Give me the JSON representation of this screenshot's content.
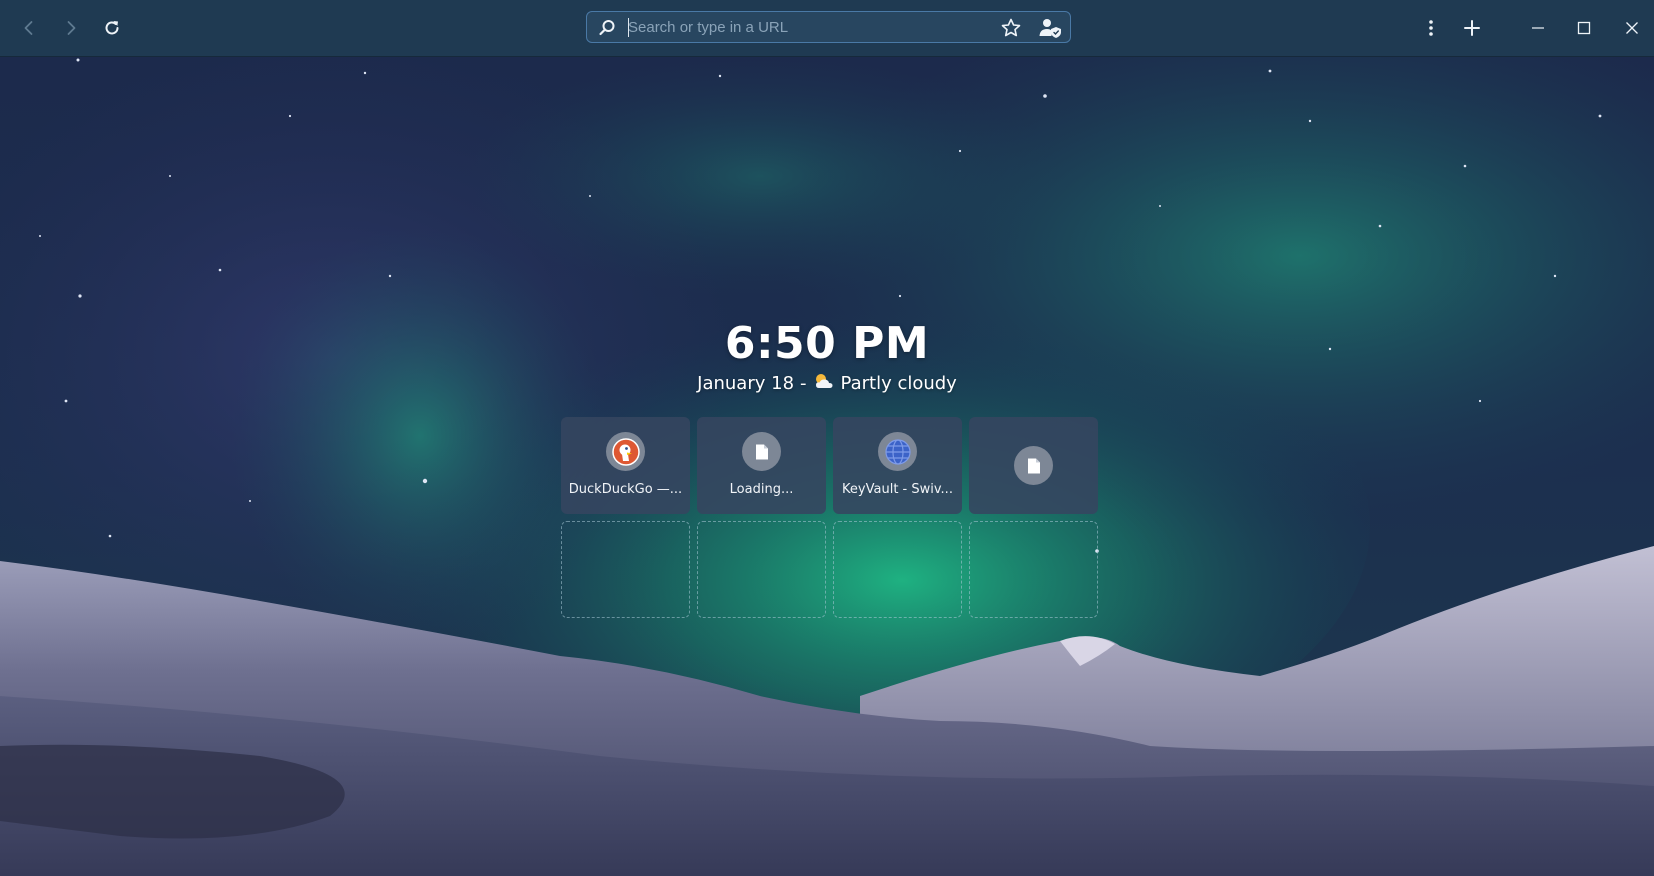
{
  "toolbar": {
    "back_icon": "chevron-left-icon",
    "forward_icon": "chevron-right-icon",
    "reload_icon": "reload-icon",
    "menu_icon": "kebab-menu-icon",
    "new_tab_icon": "plus-icon",
    "minimize_icon": "minimize-icon",
    "maximize_icon": "maximize-icon",
    "close_icon": "close-icon"
  },
  "urlbar": {
    "placeholder": "Search or type in a URL",
    "value": "",
    "search_icon": "search-icon",
    "bookmark_icon": "star-icon",
    "profile_icon": "user-shield-icon"
  },
  "clock": {
    "time": "6:50 PM",
    "date": "January 18",
    "separator": "-",
    "weather": "Partly cloudy",
    "weather_icon": "partly-cloudy-icon"
  },
  "speed_dial": {
    "tiles": [
      {
        "label": "DuckDuckGo —...",
        "icon": "duckduckgo-icon"
      },
      {
        "label": "Loading...",
        "icon": "document-icon"
      },
      {
        "label": "KeyVault - Swiv...",
        "icon": "globe-icon"
      },
      {
        "label": "",
        "icon": "document-icon"
      }
    ],
    "empty_slots": 4
  },
  "colors": {
    "toolbar_bg": "#1f3a52",
    "urlbar_border": "#4a79a6",
    "tile_bg": "#364660",
    "aurora": "#1fa47a",
    "duckduckgo": "#de5833"
  }
}
